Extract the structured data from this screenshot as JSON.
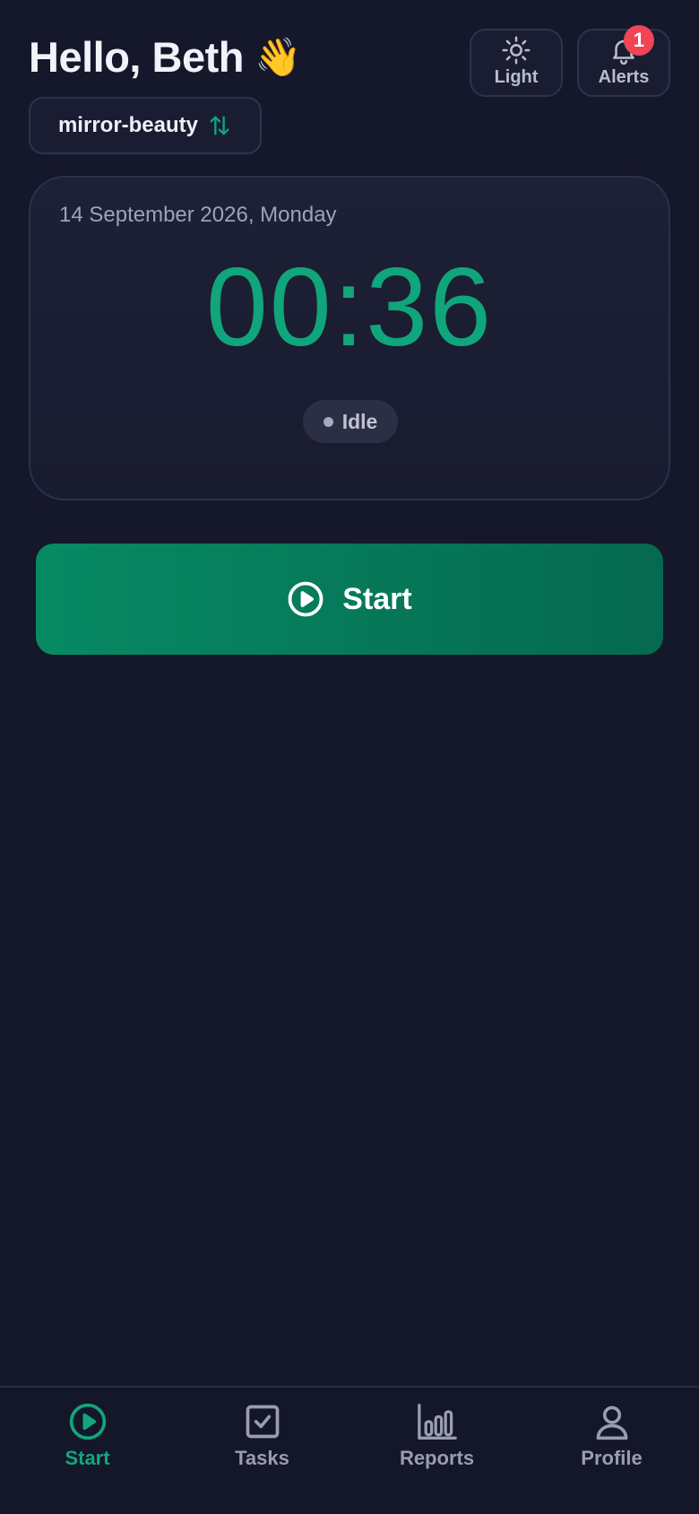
{
  "header": {
    "greeting": "Hello, Beth",
    "wave_emoji": "👋",
    "theme_button_label": "Light",
    "alerts_button_label": "Alerts",
    "alerts_count": "1"
  },
  "workspace": {
    "name": "mirror-beauty",
    "switch_icon": "swap-vertical-icon"
  },
  "timer_card": {
    "date": "14 September 2026, Monday",
    "time": "00:36",
    "status": "Idle"
  },
  "start_button": {
    "label": "Start",
    "icon": "play-circle-icon"
  },
  "bottom_nav": {
    "items": [
      {
        "label": "Start",
        "icon": "play-circle-icon",
        "active": true
      },
      {
        "label": "Tasks",
        "icon": "checkbox-icon",
        "active": false
      },
      {
        "label": "Reports",
        "icon": "bar-chart-icon",
        "active": false
      },
      {
        "label": "Profile",
        "icon": "user-icon",
        "active": false
      }
    ]
  },
  "colors": {
    "background": "#15172a",
    "accent": "#10a57a",
    "badge": "#f04457"
  }
}
